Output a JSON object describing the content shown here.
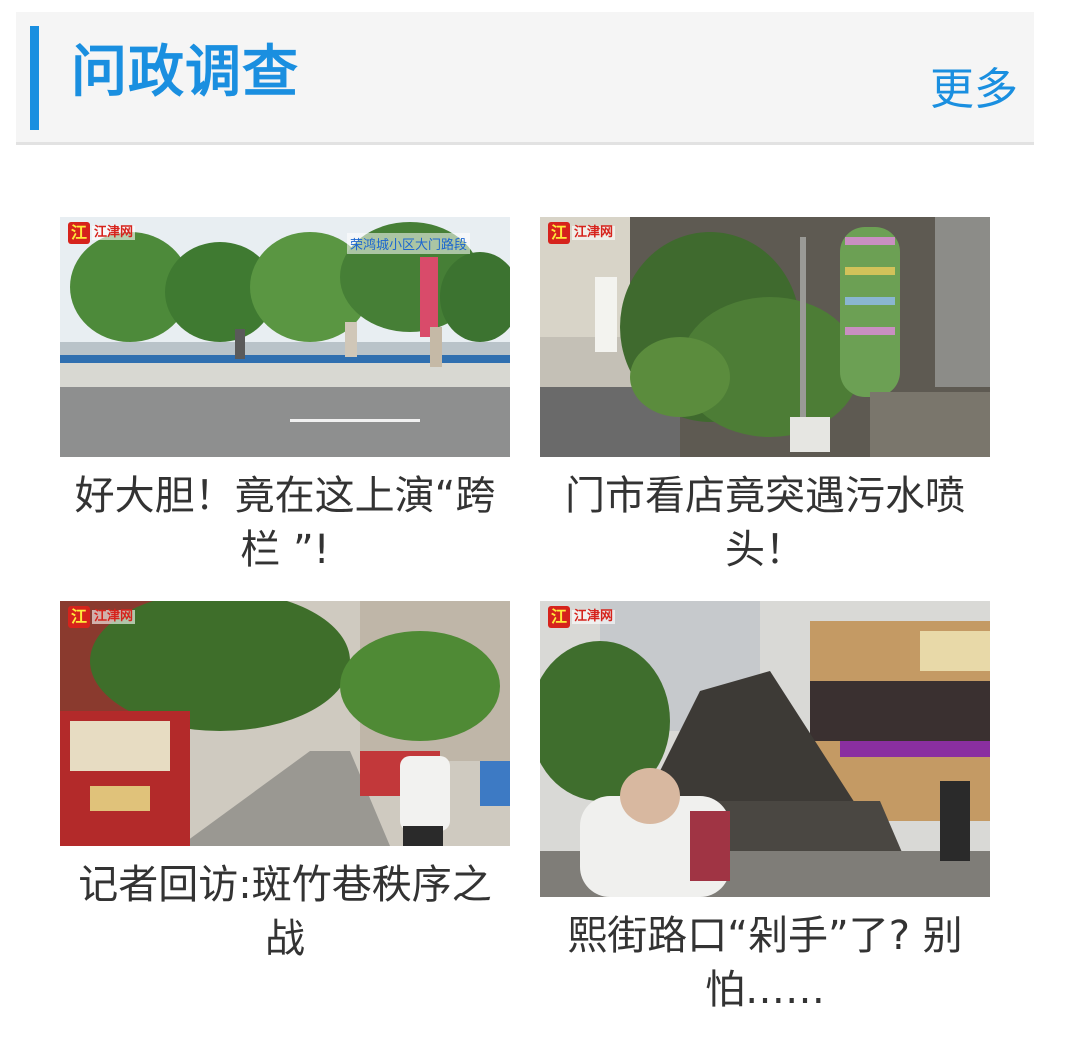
{
  "header": {
    "title": "问政调查",
    "more_label": "更多",
    "accent_color": "#1a8fe0"
  },
  "watermark": {
    "logo_char": "江",
    "logo_text": "江津网"
  },
  "articles": [
    {
      "title": "好大胆！竟在这上演“跨栏 ”!",
      "image_overlay": "荣鸿城小区大门路段"
    },
    {
      "title": "门市看店竟突遇污水喷头！"
    },
    {
      "title": "记者回访:斑竹巷秩序之战"
    },
    {
      "title": "熙街路口“剁手”了? 别怕……"
    }
  ]
}
